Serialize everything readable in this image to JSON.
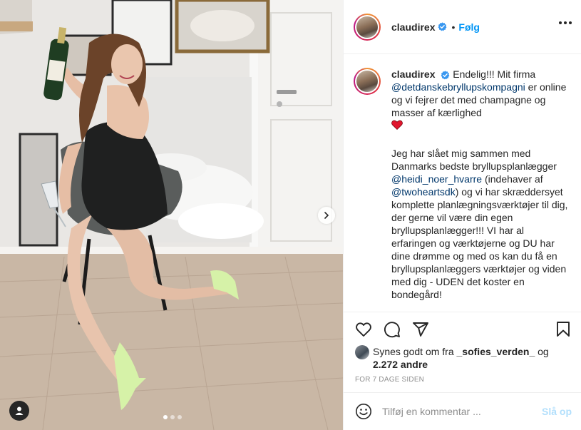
{
  "post": {
    "author": "claudirex",
    "verified": true,
    "follow_separator": "•",
    "follow_label": "Følg",
    "more_icon": "ellipsis-icon",
    "carousel": {
      "slide_count": 3,
      "active_index": 0
    }
  },
  "caption": {
    "author": "claudirex",
    "p1_text": "Endelig!!! Mit firma",
    "mention_1": "@detdanskebryllupskompagni",
    "p1_text2": "er online og vi fejrer det med champagne og masser af kærlighed",
    "emoji": "❤️",
    "p2_text1": "Jeg har slået mig sammen med Danmarks bedste bryllupsplanlægger",
    "mention_2": "@heidi_noer_hvarre",
    "p2_text2": "(indehaver af",
    "mention_3": "@twoheartsdk",
    "p2_text3": ") og vi har skræddersyet komplette planlægningsværktøjer til dig, der gerne vil være din egen bryllupsplanlægger!!! VI har al erfaringen og værktøjerne og DU har dine drømme og med os kan du få en bryllupsplanlæggers værktøjer og viden med dig - UDEN det koster en bondegård!"
  },
  "actions": {
    "icons": [
      "heart-icon",
      "comment-icon",
      "share-icon",
      "bookmark-icon"
    ]
  },
  "likes": {
    "prefix": "Synes godt om fra",
    "user": "_sofies_verden_",
    "joiner": "og",
    "count": "2.272 andre"
  },
  "timestamp": "For 7 dage siden",
  "comment": {
    "placeholder": "Tilføj en kommentar ...",
    "post_label": "Slå op"
  },
  "colors": {
    "accent": "#0095f6",
    "link": "#00376b",
    "post_disabled": "#b2dffc",
    "muted": "#8e8e8e"
  }
}
